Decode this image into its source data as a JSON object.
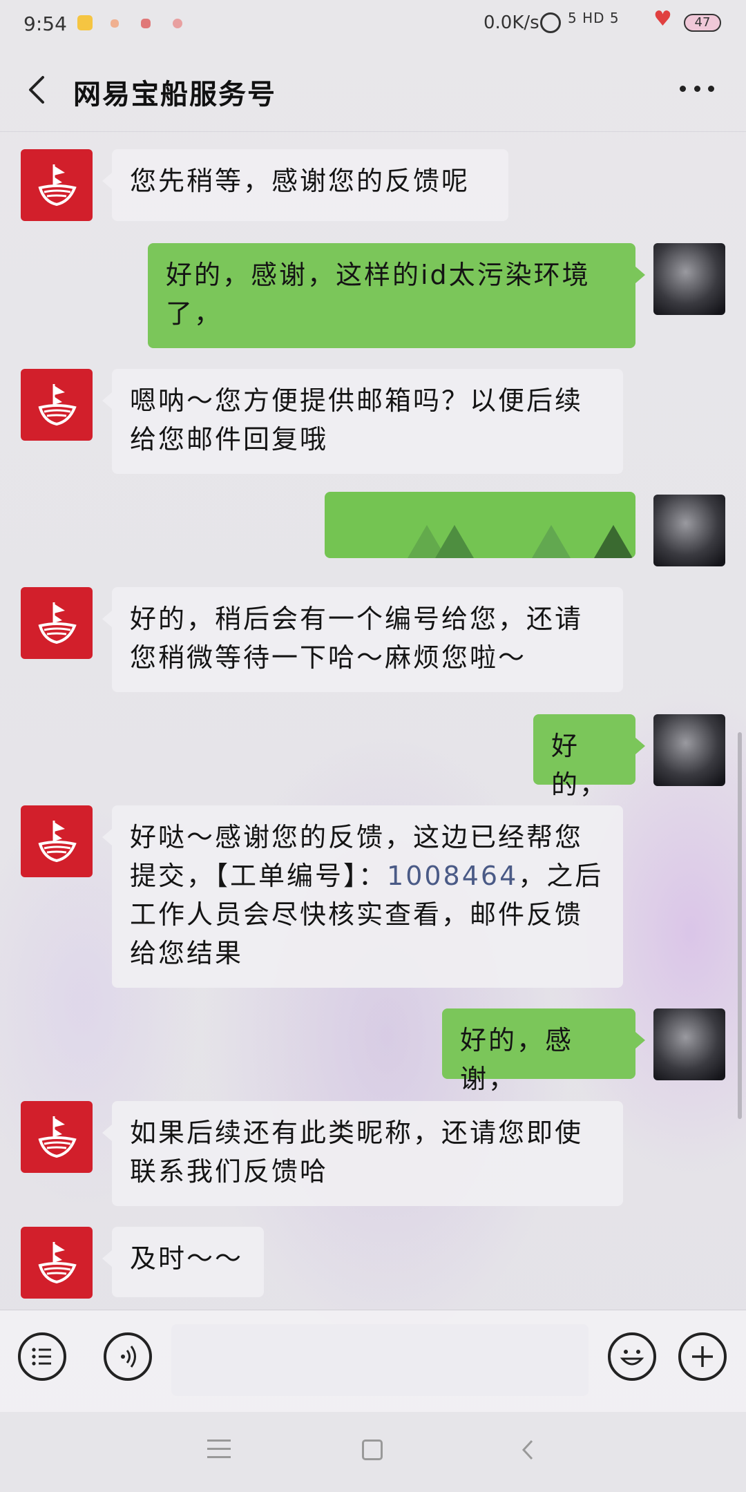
{
  "status_bar": {
    "time": "9:54",
    "network_speed": "0.0K/s",
    "signal": "5 HD 5",
    "battery": "47"
  },
  "header": {
    "title": "网易宝船服务号",
    "back_icon": "chevron-left-icon",
    "more_icon": "more-dots-icon"
  },
  "messages": [
    {
      "side": "left",
      "text": "您先稍等，感谢您的反馈呢"
    },
    {
      "side": "right",
      "text": "好的，感谢，这样的id太污染环境了，"
    },
    {
      "side": "left",
      "text": "嗯呐～您方便提供邮箱吗？以便后续给您邮件回复哦"
    },
    {
      "side": "right",
      "text": ""
    },
    {
      "side": "left",
      "text": "好的，稍后会有一个编号给您，还请您稍微等待一下哈～麻烦您啦～"
    },
    {
      "side": "right",
      "text": "好的，"
    },
    {
      "side": "left",
      "text_before": "好哒～感谢您的反馈，这边已经帮您提交，【工单编号】：",
      "ticket": "1008464",
      "text_after": "，之后工作人员会尽快核实查看，邮件反馈给您结果"
    },
    {
      "side": "right",
      "text": "好的，感谢，"
    },
    {
      "side": "left",
      "text": "如果后续还有此类昵称，还请您即使联系我们反馈哈"
    },
    {
      "side": "left",
      "text": "及时～～"
    }
  ],
  "input_bar": {
    "menu_icon": "list-menu-icon",
    "voice_icon": "voice-icon",
    "emoji_icon": "emoji-icon",
    "add_icon": "plus-icon"
  },
  "colors": {
    "sent_bubble": "#7bc65a",
    "received_bubble": "#f0eff2",
    "brand_red": "#d21f2b",
    "ticket_link": "#4a5a86"
  }
}
